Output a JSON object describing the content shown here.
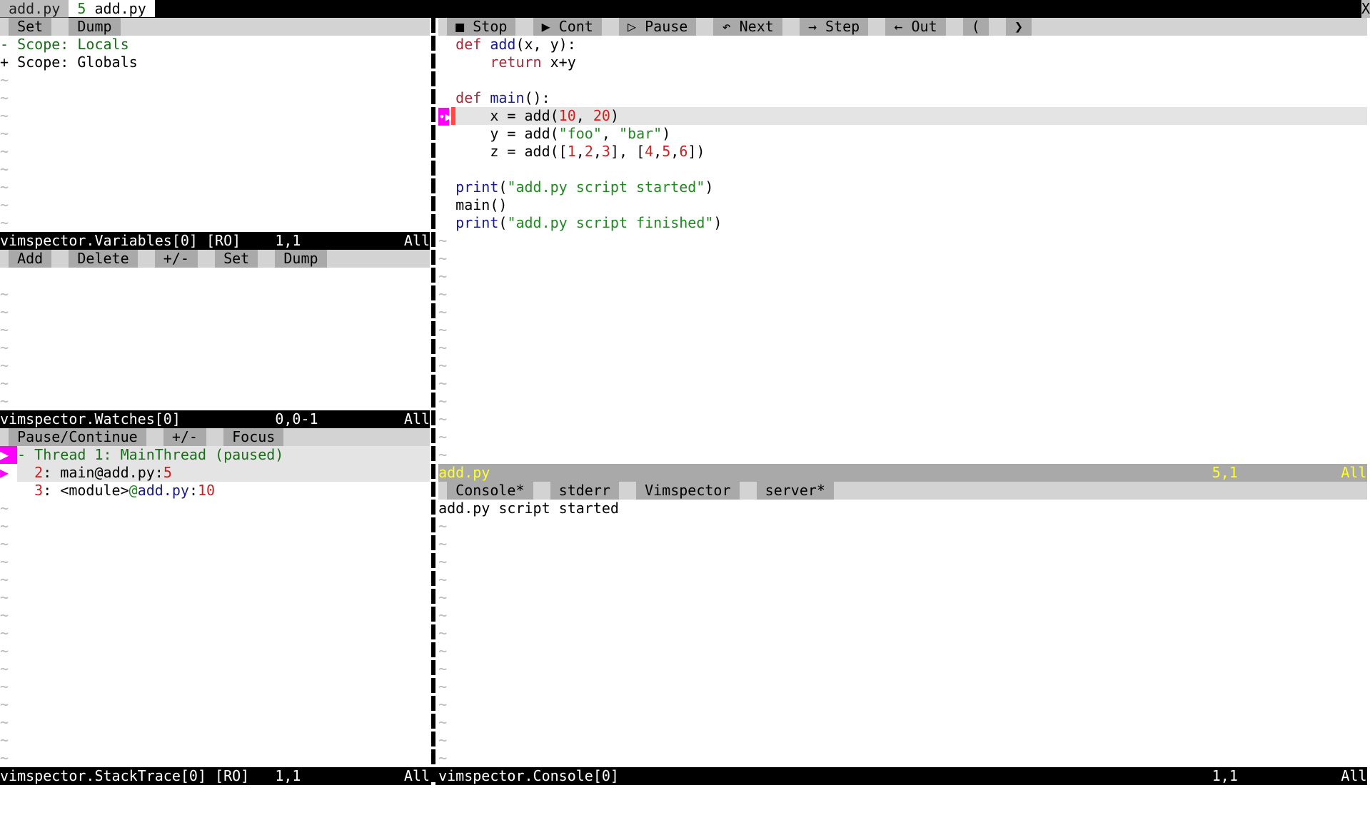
{
  "tabline": {
    "tab1": "add.py",
    "tab2_count": "5",
    "tab2_name": "add.py",
    "close": "X"
  },
  "variables": {
    "toolbar": [
      "Set",
      "Dump"
    ],
    "lines": [
      {
        "prefix": "- ",
        "text": "Scope: Locals",
        "expanded": true
      },
      {
        "prefix": "+ ",
        "text": "Scope: Globals",
        "expanded": false
      }
    ],
    "status": {
      "name": "vimspector.Variables[0] [RO]",
      "pos": "1,1",
      "scroll": "All"
    }
  },
  "watches": {
    "toolbar": [
      "Add",
      "Delete",
      "+/-",
      "Set",
      "Dump"
    ],
    "status": {
      "name": "vimspector.Watches[0]",
      "pos": "0,0-1",
      "scroll": "All"
    }
  },
  "stack": {
    "toolbar": [
      "Pause/Continue",
      "+/-",
      "Focus"
    ],
    "thread": "- Thread 1: MainThread (paused)",
    "frames": [
      {
        "num": "2",
        "sep": ": ",
        "name": "main",
        "at": "@",
        "file": "add.py",
        "colon": ":",
        "line": "5"
      },
      {
        "num": "3",
        "sep": ": ",
        "name": "<module>",
        "at": "@",
        "file": "add.py",
        "colon": ":",
        "line": "10"
      }
    ],
    "status": {
      "name": "vimspector.StackTrace[0] [RO]",
      "pos": "1,1",
      "scroll": "All"
    }
  },
  "debug_toolbar": [
    {
      "icon": "■",
      "label": "Stop"
    },
    {
      "icon": "▶",
      "label": "Cont"
    },
    {
      "icon": "▷",
      "label": "Pause"
    },
    {
      "icon": "↶",
      "label": "Next"
    },
    {
      "icon": "→",
      "label": "Step"
    },
    {
      "icon": "←",
      "label": "Out"
    },
    {
      "icon": "(",
      "label": ""
    },
    {
      "icon": "❯",
      "label": ""
    }
  ],
  "editor": {
    "current_line": 5,
    "sign": "•▶",
    "lines": [
      [
        {
          "t": "def",
          "c": "kw"
        },
        {
          "t": " "
        },
        {
          "t": "add",
          "c": "fn"
        },
        {
          "t": "(x, y):"
        }
      ],
      [
        {
          "t": "    "
        },
        {
          "t": "return",
          "c": "kw"
        },
        {
          "t": " x+y"
        }
      ],
      [],
      [
        {
          "t": "def",
          "c": "kw"
        },
        {
          "t": " "
        },
        {
          "t": "main",
          "c": "fn"
        },
        {
          "t": "():"
        }
      ],
      [
        {
          "t": "    x = add("
        },
        {
          "t": "10",
          "c": "num"
        },
        {
          "t": ", "
        },
        {
          "t": "20",
          "c": "num"
        },
        {
          "t": ")"
        }
      ],
      [
        {
          "t": "    y = add("
        },
        {
          "t": "\"foo\"",
          "c": "str"
        },
        {
          "t": ", "
        },
        {
          "t": "\"bar\"",
          "c": "str"
        },
        {
          "t": ")"
        }
      ],
      [
        {
          "t": "    z = add(["
        },
        {
          "t": "1",
          "c": "num"
        },
        {
          "t": ","
        },
        {
          "t": "2",
          "c": "num"
        },
        {
          "t": ","
        },
        {
          "t": "3",
          "c": "num"
        },
        {
          "t": "], ["
        },
        {
          "t": "4",
          "c": "num"
        },
        {
          "t": ","
        },
        {
          "t": "5",
          "c": "num"
        },
        {
          "t": ","
        },
        {
          "t": "6",
          "c": "num"
        },
        {
          "t": "])"
        }
      ],
      [],
      [
        {
          "t": "print",
          "c": "fn"
        },
        {
          "t": "("
        },
        {
          "t": "\"add.py script started\"",
          "c": "str"
        },
        {
          "t": ")"
        }
      ],
      [
        {
          "t": "main()"
        }
      ],
      [
        {
          "t": "print",
          "c": "fn"
        },
        {
          "t": "("
        },
        {
          "t": "\"add.py script finished\"",
          "c": "str"
        },
        {
          "t": ")"
        }
      ]
    ],
    "status": {
      "name": "add.py",
      "pos": "5,1",
      "scroll": "All"
    }
  },
  "console": {
    "tabs": [
      "Console*",
      "stderr",
      "Vimspector",
      "server*"
    ],
    "output": [
      "add.py script started"
    ],
    "status": {
      "name": "vimspector.Console[0]",
      "pos": "1,1",
      "scroll": "All"
    }
  },
  "tilde": "~",
  "colors": {
    "sign": "#ff00ff",
    "breakpoint": "#ff4848",
    "statusline": "#000000",
    "toolbar": "#d3d3d3",
    "button": "#a9a9a9"
  }
}
